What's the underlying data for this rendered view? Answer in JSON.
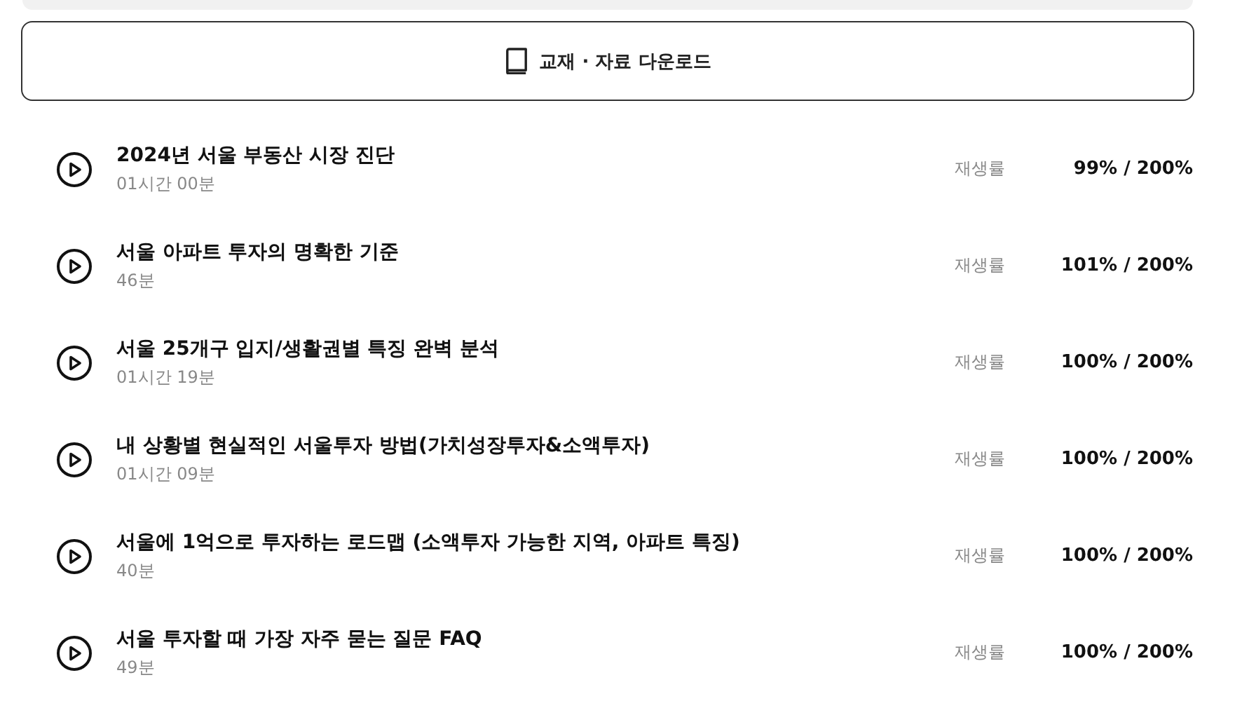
{
  "download_button": {
    "label": "교재 · 자료 다운로드"
  },
  "lectures": [
    {
      "title": "2024년 서울 부동산 시장 진단",
      "duration": "01시간 00분",
      "rate_label": "재생률",
      "rate": "99% / 200%"
    },
    {
      "title": "서울 아파트 투자의 명확한 기준",
      "duration": "46분",
      "rate_label": "재생률",
      "rate": "101% / 200%"
    },
    {
      "title": "서울 25개구 입지/생활권별 특징 완벽 분석",
      "duration": "01시간 19분",
      "rate_label": "재생률",
      "rate": "100% / 200%"
    },
    {
      "title": "내 상황별 현실적인 서울투자 방법(가치성장투자&소액투자)",
      "duration": "01시간 09분",
      "rate_label": "재생률",
      "rate": "100% / 200%"
    },
    {
      "title": "서울에 1억으로 투자하는 로드맵 (소액투자 가능한 지역, 아파트 특징)",
      "duration": "40분",
      "rate_label": "재생률",
      "rate": "100% / 200%"
    },
    {
      "title": "서울 투자할 때 가장 자주 묻는 질문 FAQ",
      "duration": "49분",
      "rate_label": "재생률",
      "rate": "100% / 200%"
    }
  ]
}
